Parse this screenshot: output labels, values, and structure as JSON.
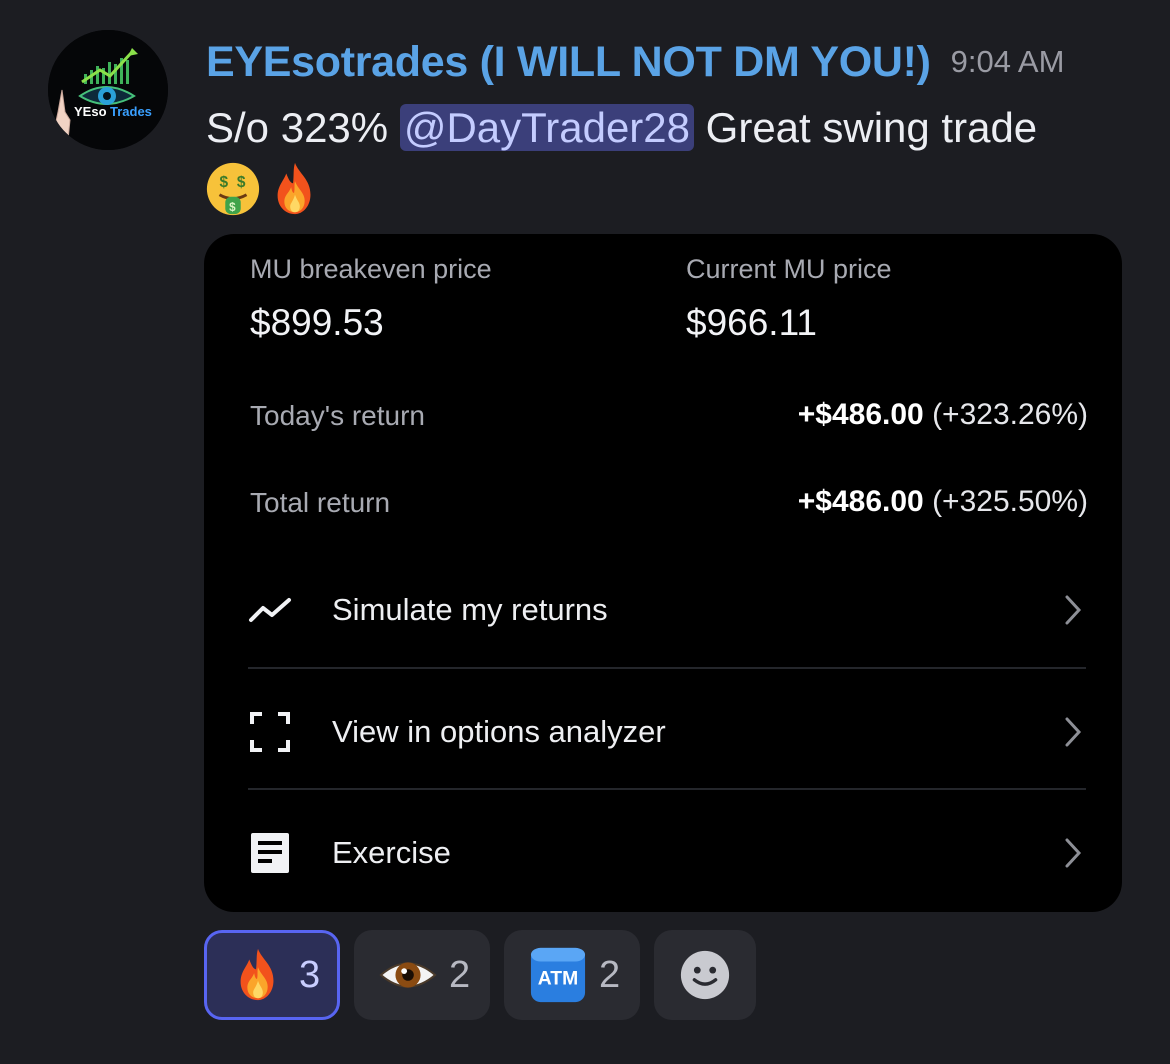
{
  "message": {
    "username": "EYEsotrades (I WILL NOT DM YOU!)",
    "timestamp": "9:04 AM",
    "text_before_mention": "S/o 323% ",
    "mention": "@DayTrader28",
    "text_after_mention": " Great swing trade",
    "emojis": [
      "money-mouth-face",
      "fire"
    ],
    "avatar": {
      "logo_text": "YEsoTrades",
      "icon": "eye-chart-logo"
    }
  },
  "card": {
    "breakeven_label": "MU breakeven price",
    "breakeven_value": "$899.53",
    "current_label": "Current MU price",
    "current_value": "$966.11",
    "todays_return_label": "Today's return",
    "todays_return_amount": "+$486.00",
    "todays_return_pct": "(+323.26%)",
    "total_return_label": "Total return",
    "total_return_amount": "+$486.00",
    "total_return_pct": "(+325.50%)",
    "actions": [
      {
        "label": "Simulate my returns",
        "icon": "trend-line-icon"
      },
      {
        "label": "View in options analyzer",
        "icon": "frame-corners-icon"
      },
      {
        "label": "Exercise",
        "icon": "document-icon"
      }
    ]
  },
  "reactions": [
    {
      "emoji": "fire",
      "count": "3",
      "active": true
    },
    {
      "emoji": "eye",
      "count": "2",
      "active": false
    },
    {
      "emoji": "atm",
      "count": "2",
      "active": false,
      "emoji_text": "ATM"
    }
  ],
  "colors": {
    "background": "#1c1d22",
    "username": "#5aa3e6",
    "mention_bg": "#3b3f7a",
    "active_reaction_border": "#5865f2"
  }
}
